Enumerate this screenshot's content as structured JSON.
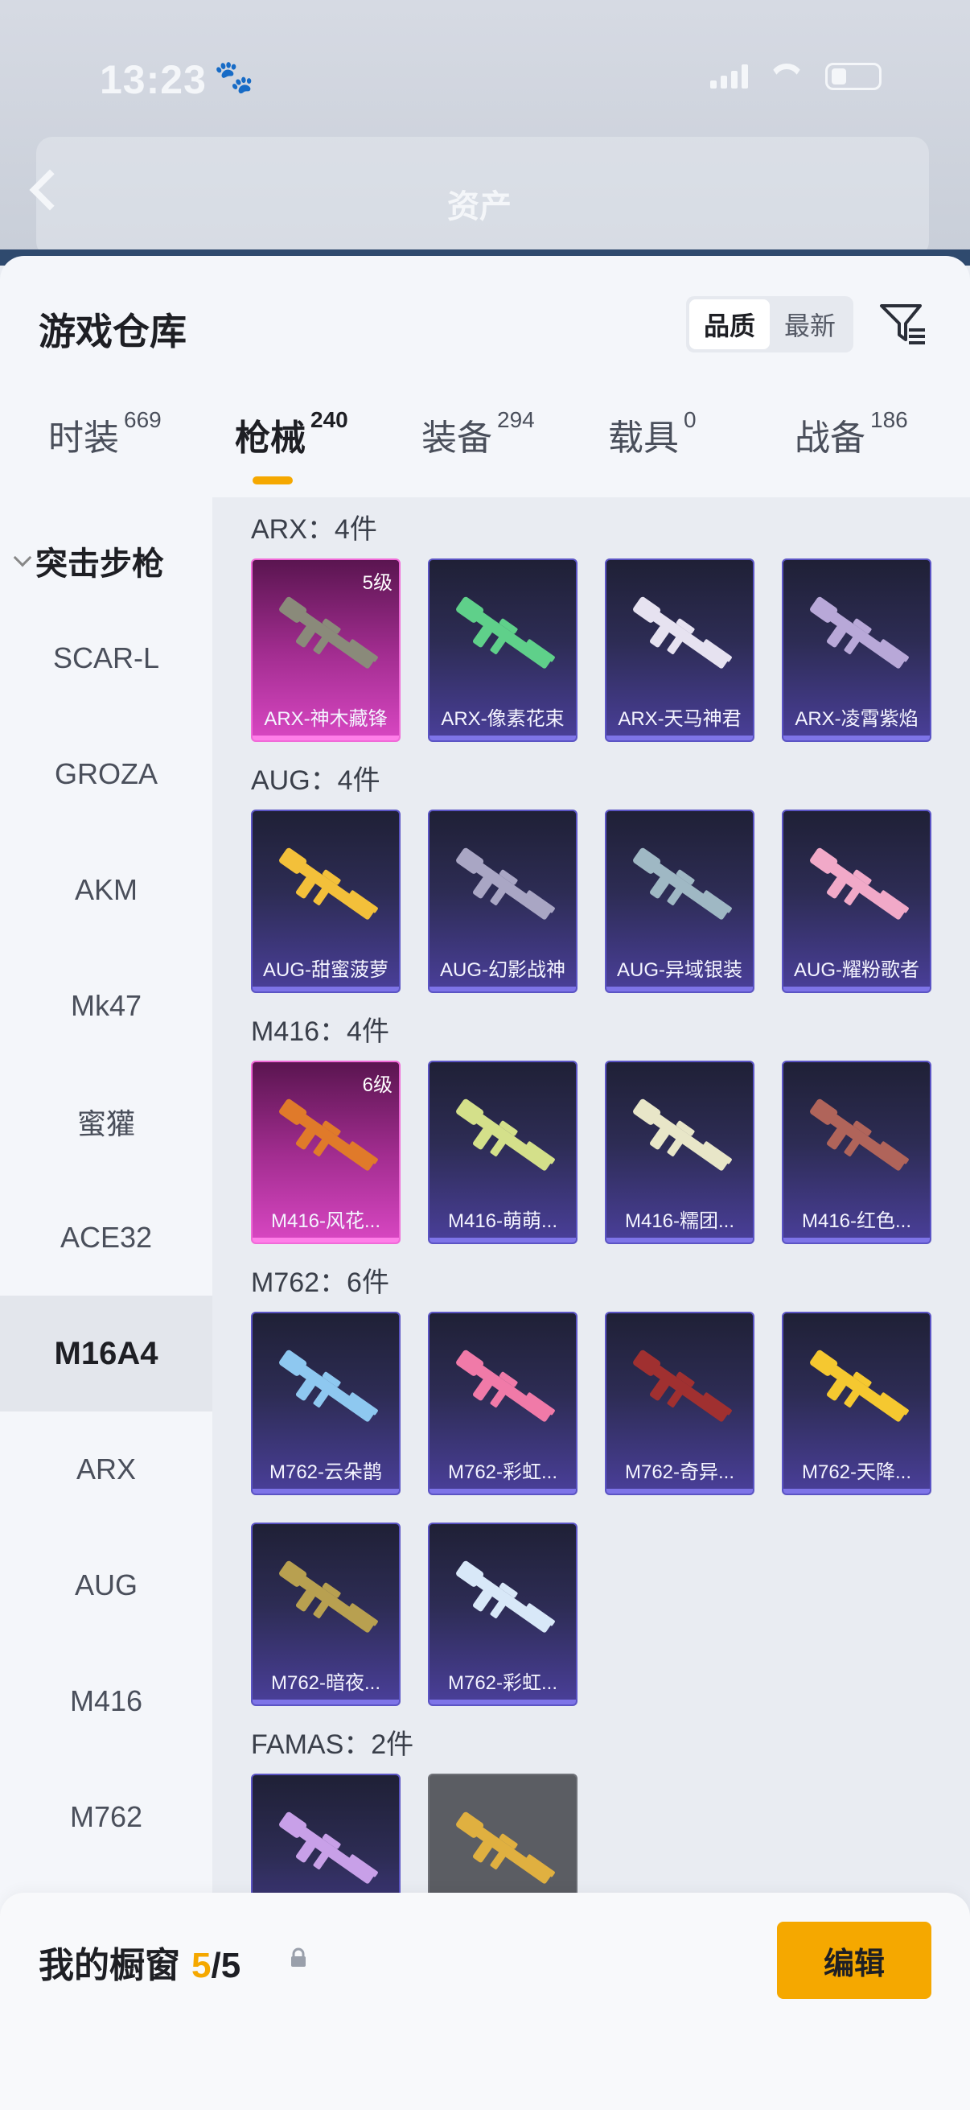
{
  "status_bar": {
    "time": "13:23"
  },
  "background_header": {
    "title": "资产"
  },
  "sheet": {
    "title": "游戏仓库"
  },
  "sort": {
    "options": [
      "品质",
      "最新"
    ],
    "active": "品质"
  },
  "categories": [
    {
      "label": "时装",
      "count": "669"
    },
    {
      "label": "枪械",
      "count": "240"
    },
    {
      "label": "装备",
      "count": "294"
    },
    {
      "label": "载具",
      "count": "0"
    },
    {
      "label": "战备",
      "count": "186"
    }
  ],
  "sidebar": {
    "group": "突击步枪",
    "items": [
      "SCAR-L",
      "GROZA",
      "AKM",
      "Mk47",
      "蜜獾",
      "ACE32",
      "M16A4",
      "ARX",
      "AUG",
      "M416",
      "M762"
    ],
    "active": "M16A4"
  },
  "sections": [
    {
      "header": "ARX：4件",
      "cards": [
        {
          "name": "ARX-神木藏锋",
          "grade": "5级",
          "style": "pink",
          "color": "#8a8a7a"
        },
        {
          "name": "ARX-像素花束",
          "style": "normal",
          "color": "#5fd08a"
        },
        {
          "name": "ARX-天马神君",
          "style": "normal",
          "color": "#e6e2f0"
        },
        {
          "name": "ARX-凌霄紫焰",
          "style": "normal",
          "color": "#b8a8d8"
        }
      ]
    },
    {
      "header": "AUG：4件",
      "cards": [
        {
          "name": "AUG-甜蜜菠萝",
          "style": "normal",
          "color": "#f3c03a"
        },
        {
          "name": "AUG-幻影战神",
          "style": "normal",
          "color": "#a9a6c4"
        },
        {
          "name": "AUG-异域银装",
          "style": "normal",
          "color": "#9fb8c4"
        },
        {
          "name": "AUG-耀粉歌者",
          "style": "normal",
          "color": "#f1a9c8"
        }
      ]
    },
    {
      "header": "M416：4件",
      "cards": [
        {
          "name": "M416-风花...",
          "grade": "6级",
          "style": "pink",
          "color": "#e07a2a"
        },
        {
          "name": "M416-萌萌...",
          "style": "normal",
          "color": "#d4e08a"
        },
        {
          "name": "M416-糯团...",
          "style": "normal",
          "color": "#e8e6c8"
        },
        {
          "name": "M416-红色...",
          "style": "normal",
          "color": "#b0645a"
        }
      ]
    },
    {
      "header": "M762：6件",
      "cards": [
        {
          "name": "M762-云朵鹊",
          "style": "normal",
          "color": "#8ec8f0"
        },
        {
          "name": "M762-彩虹...",
          "style": "normal",
          "color": "#f07aa8"
        },
        {
          "name": "M762-奇异...",
          "style": "normal",
          "color": "#a03030"
        },
        {
          "name": "M762-天降...",
          "style": "normal",
          "color": "#f5c830"
        },
        {
          "name": "M762-暗夜...",
          "style": "normal",
          "color": "#b8a050"
        },
        {
          "name": "M762-彩虹...",
          "style": "normal",
          "color": "#d8e8f8"
        }
      ]
    },
    {
      "header": "FAMAS：2件",
      "cards": [
        {
          "name": "",
          "style": "normal",
          "color": "#c8a0e8"
        },
        {
          "name": "",
          "style": "gray",
          "color": "#e0b040"
        }
      ]
    }
  ],
  "showcase": {
    "label": "我的橱窗",
    "count": "5",
    "total": "/5",
    "edit_label": "编辑"
  },
  "colors": {
    "accent": "#f5a800",
    "card_border": "#5b54c4",
    "pink_border": "#f06ad8"
  }
}
